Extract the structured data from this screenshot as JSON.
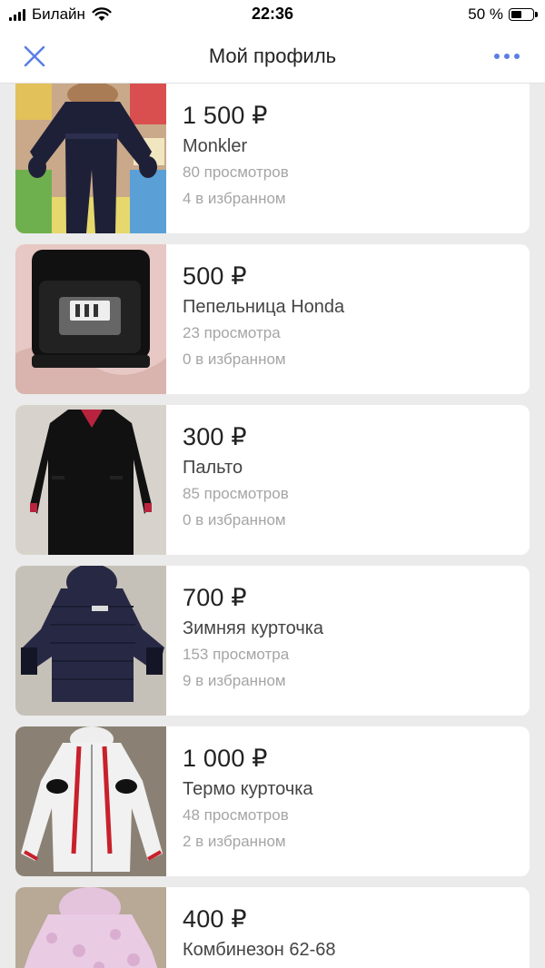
{
  "status_bar": {
    "carrier": "Билайн",
    "time": "22:36",
    "battery": "50 %",
    "battery_level": 0.5
  },
  "nav": {
    "title": "Мой профиль",
    "close_icon": "close-icon",
    "more_icon": "more-icon",
    "accent": "#5b7ee5"
  },
  "listings": [
    {
      "price": "1 500 ₽",
      "title": "Monkler",
      "views": "80 просмотров",
      "favorites": "4 в избранном",
      "image": "dark-navy-snowsuit"
    },
    {
      "price": "500 ₽",
      "title": "Пепельница Honda",
      "views": "23 просмотра",
      "favorites": "0 в избранном",
      "image": "black-car-ashtray"
    },
    {
      "price": "300 ₽",
      "title": "Пальто",
      "views": "85 просмотров",
      "favorites": "0 в избранном",
      "image": "black-coat"
    },
    {
      "price": "700 ₽",
      "title": "Зимняя курточка",
      "views": "153 просмотра",
      "favorites": "9 в избранном",
      "image": "navy-puffer-jacket"
    },
    {
      "price": "1 000 ₽",
      "title": "Термо курточка",
      "views": "48 просмотров",
      "favorites": "2 в избранном",
      "image": "white-red-ski-jacket"
    },
    {
      "price": "400 ₽",
      "title": "Комбинезон 62-68",
      "image": "pink-fur-overall"
    }
  ]
}
